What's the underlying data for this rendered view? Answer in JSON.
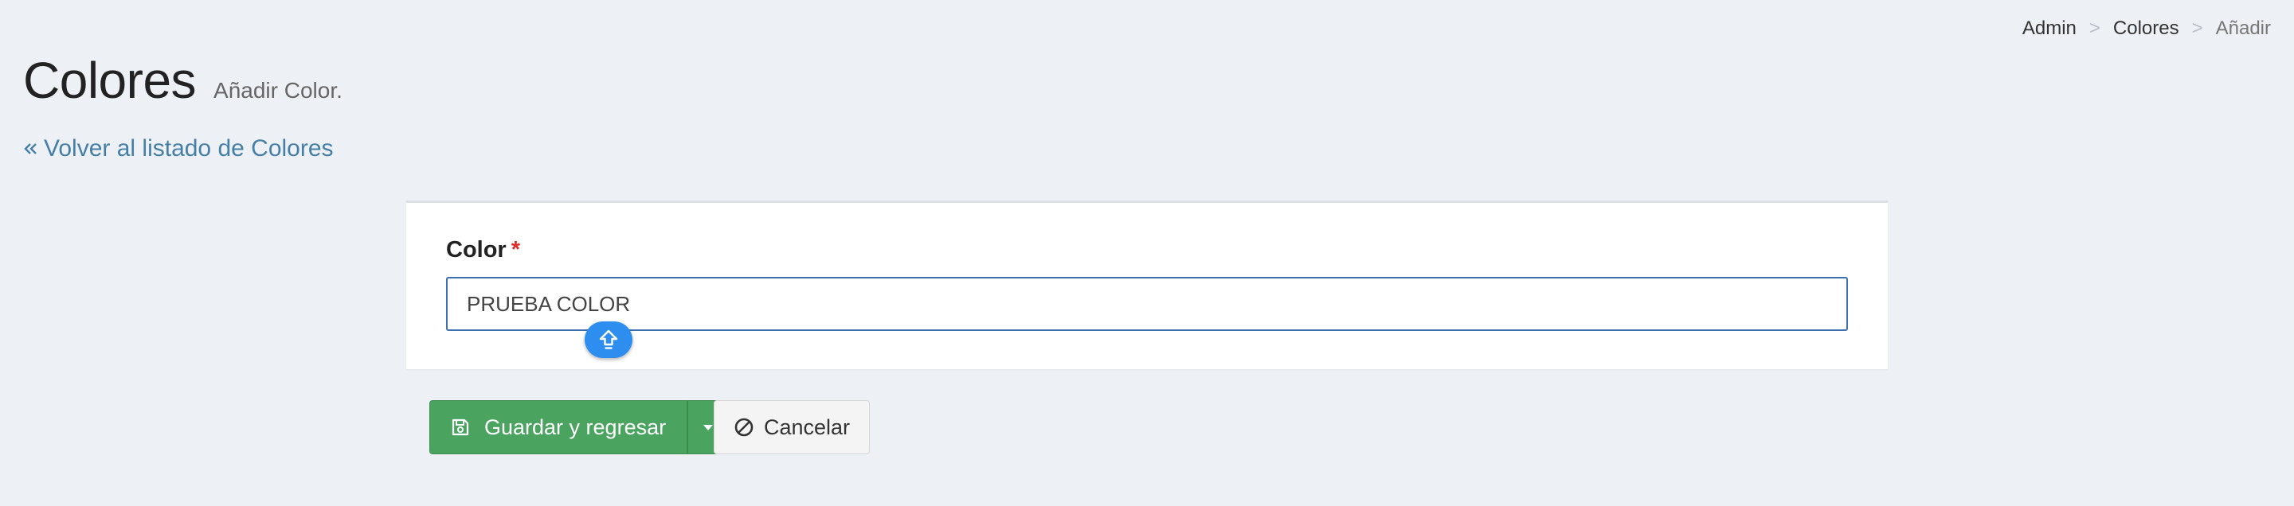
{
  "breadcrumb": {
    "items": [
      {
        "label": "Admin"
      },
      {
        "label": "Colores"
      },
      {
        "label": "Añadir"
      }
    ],
    "separator": ">"
  },
  "header": {
    "title": "Colores",
    "subtitle": "Añadir Color."
  },
  "back_link": {
    "label": "Volver al listado de Colores",
    "icon": "angle-double-left-icon"
  },
  "form": {
    "color_field": {
      "label": "Color",
      "required_mark": "*",
      "value": "PRUEBA COLOR"
    },
    "shift_indicator_icon": "shift-arrow-icon"
  },
  "actions": {
    "save_label": "Guardar y regresar",
    "save_icon": "floppy-disk-icon",
    "dropdown_icon": "caret-down-icon",
    "cancel_label": "Cancelar",
    "cancel_icon": "ban-icon"
  },
  "colors": {
    "background": "#edf0f5",
    "link": "#467fa6",
    "save_button": "#4aa460",
    "required": "#e02b27",
    "input_focus_border": "#3c6fb0",
    "shift_badge": "#2d8ef0"
  }
}
